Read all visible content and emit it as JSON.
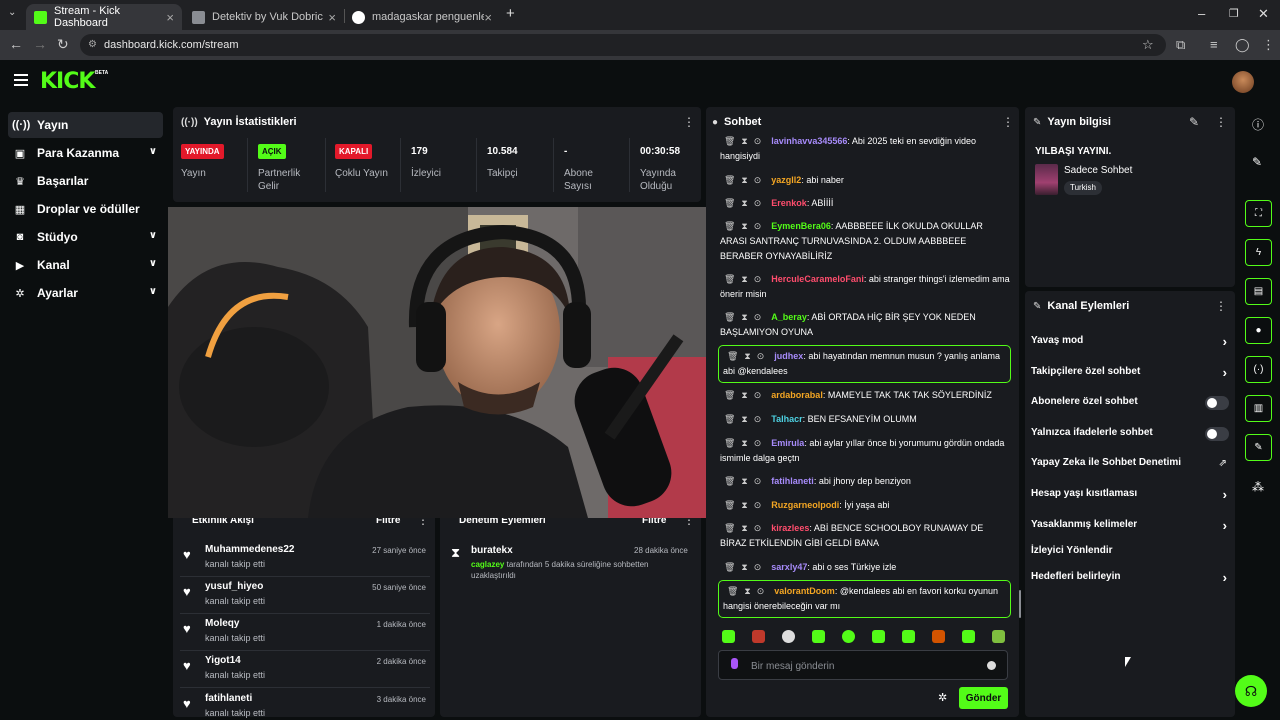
{
  "browser": {
    "tabs": [
      {
        "title": "Stream - Kick Dashboard",
        "active": true
      },
      {
        "title": "Detektiv by Vuk Dobric",
        "active": false
      },
      {
        "title": "madagaskar penguenleri peng…",
        "active": false
      }
    ],
    "new_tab": "+",
    "url": "dashboard.kick.com/stream"
  },
  "app": {
    "logo": "KICK",
    "logo_badge": "BETA"
  },
  "sidebar": {
    "items": [
      {
        "label": "Yayın",
        "icon": "broadcast-icon",
        "expandable": false
      },
      {
        "label": "Para Kazanma",
        "icon": "money-icon",
        "expandable": true
      },
      {
        "label": "Başarılar",
        "icon": "trophy-icon",
        "expandable": false
      },
      {
        "label": "Droplar ve ödüller",
        "icon": "gift-icon",
        "expandable": false
      },
      {
        "label": "Stüdyo",
        "icon": "studio-icon",
        "expandable": true
      },
      {
        "label": "Kanal",
        "icon": "channel-icon",
        "expandable": true
      },
      {
        "label": "Ayarlar",
        "icon": "gear-icon",
        "expandable": true
      }
    ]
  },
  "stats": {
    "title": "Yayın İstatistikleri",
    "items": [
      {
        "badge": "YAYINDA",
        "label": "Yayın"
      },
      {
        "badge": "AÇIK",
        "label": "Partnerlik Gelir"
      },
      {
        "badge": "KAPALI",
        "label": "Çoklu Yayın"
      },
      {
        "value": "179",
        "label": "İzleyici"
      },
      {
        "value": "10.584",
        "label": "Takipçi"
      },
      {
        "value": "-",
        "label": "Abone Sayısı"
      },
      {
        "value": "00:30:58",
        "label": "Yayında Olduğu"
      }
    ]
  },
  "activity": {
    "title": "Etkinlik Akışı",
    "filter": "Filtre",
    "items": [
      {
        "name": "Muhammedenes22",
        "action": "kanalı takip etti",
        "time": "27 saniye önce"
      },
      {
        "name": "yusuf_hiyeo",
        "action": "kanalı takip etti",
        "time": "50 saniye önce"
      },
      {
        "name": "Moleqy",
        "action": "kanalı takip etti",
        "time": "1 dakika önce"
      },
      {
        "name": "Yigot14",
        "action": "kanalı takip etti",
        "time": "2 dakika önce"
      },
      {
        "name": "fatihlaneti",
        "action": "kanalı takip etti",
        "time": "3 dakika önce"
      }
    ]
  },
  "moderation": {
    "title": "Denetim Eylemleri",
    "filter": "Filtre",
    "items": [
      {
        "name": "buratekx",
        "moderator": "caglazey",
        "text": "tarafından 5 dakika süreliğine sohbetten uzaklaştırıldı",
        "time": "28 dakika önce"
      }
    ]
  },
  "chat": {
    "title": "Sohbet",
    "messages": [
      {
        "user": "lavinhavva345566",
        "color": "#a78bfa",
        "text": "Abi 2025 teki en sevdiğin video hangisiydi"
      },
      {
        "user": "yazgll2",
        "color": "#f4a623",
        "text": "abi naber"
      },
      {
        "user": "Erenkok",
        "color": "#ff4d6d",
        "text": "ABİİİİ"
      },
      {
        "user": "EymenBera06",
        "color": "#53fc18",
        "text": "AABBBEEE İLK OKULDA OKULLAR ARASI SANTRANÇ TURNUVASINDA 2. OLDUM AABBBEEE BERABER OYNAYABİLİRİZ"
      },
      {
        "user": "HerculeCarameloFani",
        "color": "#ff4d6d",
        "text": "abi stranger things'i izlemedim ama önerir misin"
      },
      {
        "user": "A_beray",
        "color": "#53fc18",
        "text": "ABİ ORTADA HİÇ BİR ŞEY YOK NEDEN BAŞLAMIYON OYUNA"
      },
      {
        "user": "judhex",
        "color": "#a78bfa",
        "text": "abi hayatından memnun musun ? yanlış anlama abi @kendalees",
        "highlight": true
      },
      {
        "user": "ardaborabal",
        "color": "#f4a623",
        "text": "MAMEYLE TAK TAK TAK SÖYLERDİNİZ"
      },
      {
        "user": "Talhacr",
        "color": "#4dd0e1",
        "text": "BEN EFSANEYİM OLUMM"
      },
      {
        "user": "Emirula",
        "color": "#a78bfa",
        "text": "abi aylar yıllar önce bi yorumumu gördün ondada ismimle dalga geçtn"
      },
      {
        "user": "fatihlaneti",
        "color": "#a78bfa",
        "text": "abi jhony dep benziyon"
      },
      {
        "user": "Ruzgarneolpodi",
        "color": "#f4a623",
        "text": "İyi yaşa abi"
      },
      {
        "user": "kirazlees",
        "color": "#ff4d6d",
        "text": "ABİ BENCE SCHOOLBOY RUNAWAY DE BİRAZ ETKİLENDİN GİBİ GELDİ BANA"
      },
      {
        "user": "sarxly47",
        "color": "#a78bfa",
        "text": "abi o ses Türkiye izle"
      },
      {
        "user": "valorantDoom",
        "color": "#f4a623",
        "text": "@kendalees abi en favori korku oyunun hangisi önerebileceğin var mı",
        "highlight": true
      }
    ],
    "input_placeholder": "Bir mesaj gönderin",
    "send_label": "Gönder"
  },
  "stream_info": {
    "title": "Yayın bilgisi",
    "stream_title": "YILBAŞI YAYINI.",
    "category": "Sadece Sohbet",
    "language": "Turkish"
  },
  "channel_actions": {
    "title": "Kanal Eylemleri",
    "items": [
      {
        "label": "Yavaş mod",
        "control": "chevron"
      },
      {
        "label": "Takipçilere özel sohbet",
        "control": "chevron"
      },
      {
        "label": "Abonelere özel sohbet",
        "control": "toggle",
        "state": "off"
      },
      {
        "label": "Yalnızca ifadelerle sohbet",
        "control": "toggle",
        "state": "off"
      },
      {
        "label": "Yapay Zeka ile Sohbet Denetimi",
        "control": "external"
      },
      {
        "label": "Hesap yaşı kısıtlaması",
        "control": "chevron"
      },
      {
        "label": "Yasaklanmış kelimeler",
        "control": "chevron"
      },
      {
        "label": "İzleyici Yönlendir",
        "control": "none"
      },
      {
        "label": "Hedefleri belirleyin",
        "control": "chevron"
      }
    ]
  },
  "colors": {
    "accent": "#53fc18",
    "live": "#e3192a",
    "panel": "#191b1f",
    "background": "#0b0e0f"
  }
}
